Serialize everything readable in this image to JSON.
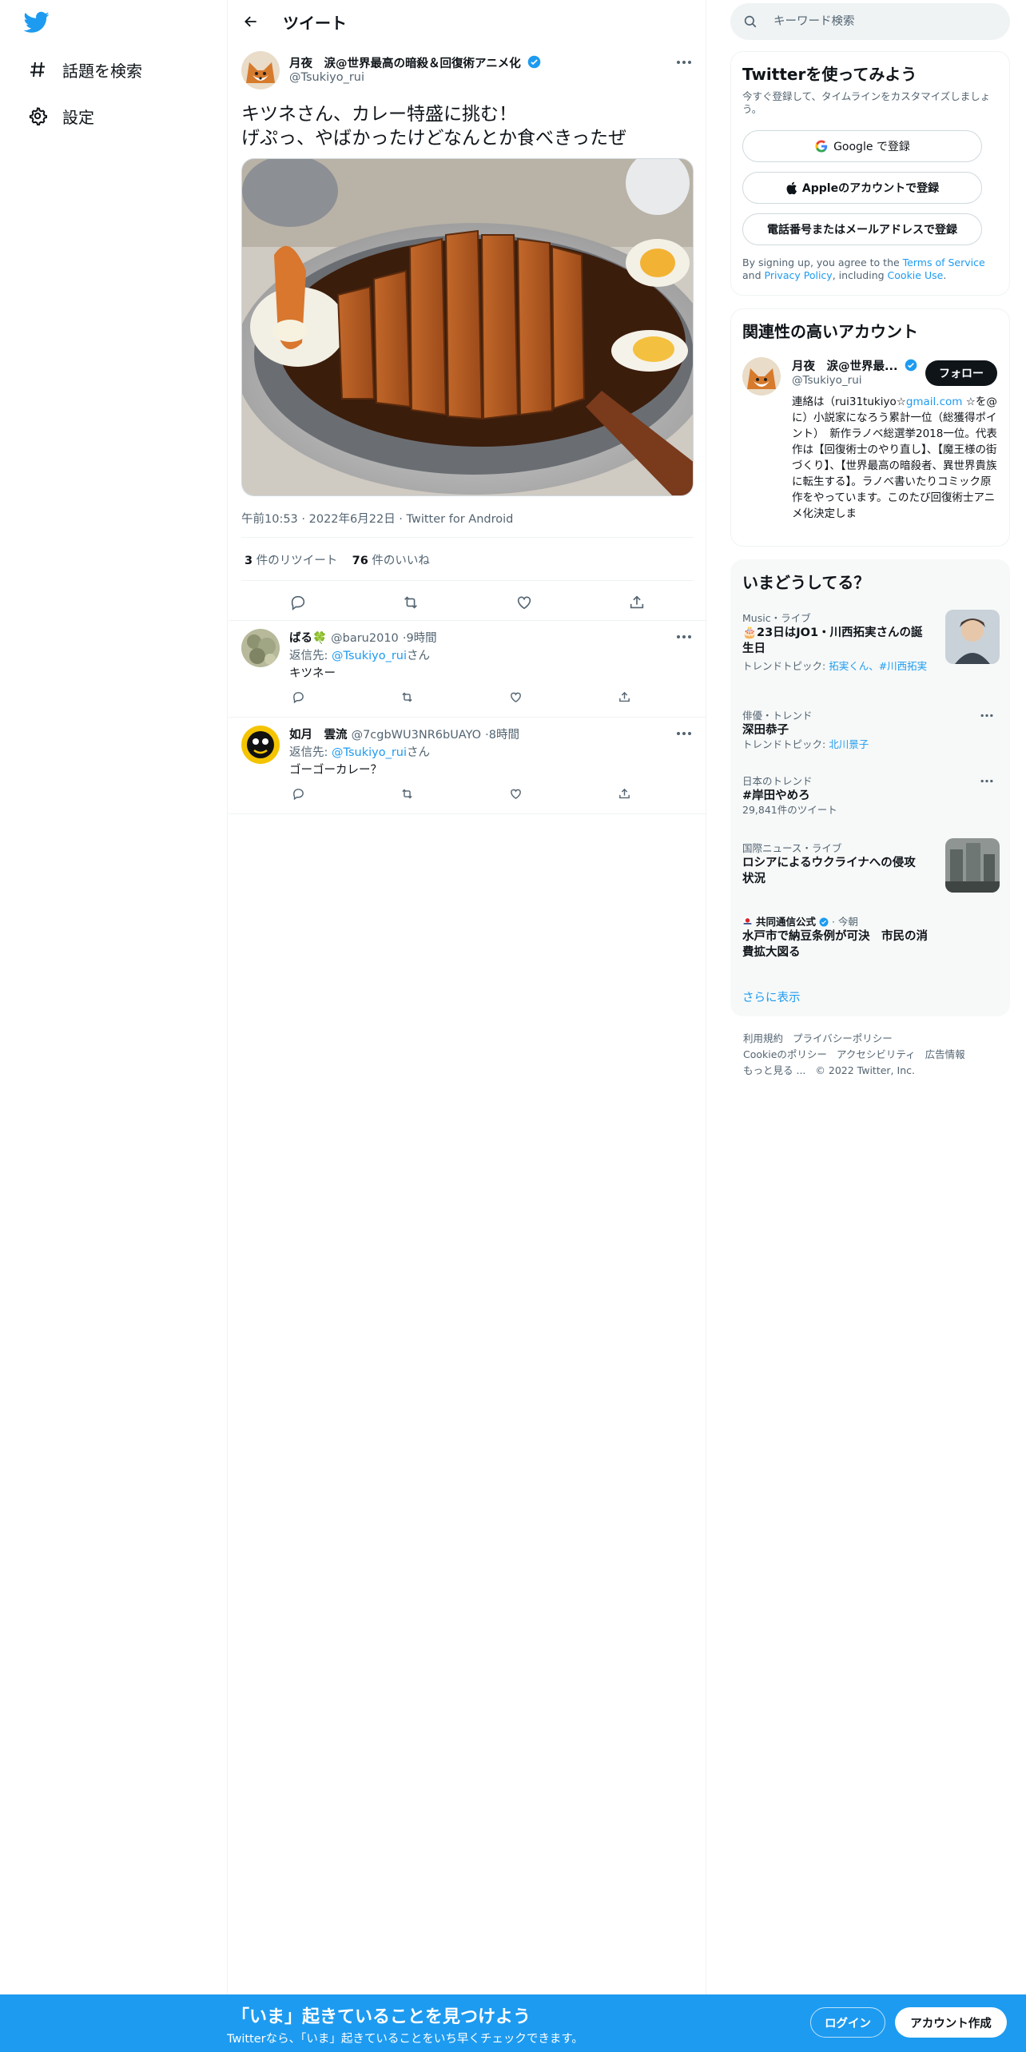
{
  "colors": {
    "brand": "#1d9bf0",
    "text": "#0f1419",
    "muted": "#536471",
    "border": "#eff3f4",
    "bottom_bar": "#1d9bf0"
  },
  "nav": {
    "logo_icon": "twitter-bird-icon",
    "items": [
      {
        "icon": "hashtag-icon",
        "label": "話題を検索"
      },
      {
        "icon": "gear-icon",
        "label": "設定"
      }
    ]
  },
  "main": {
    "header_title": "ツイート",
    "tweet": {
      "author_name": "月夜　涙@世界最高の暗殺＆回復術アニメ化",
      "author_handle": "@Tsukiyo_rui",
      "text": "キツネさん、カレー特盛に挑む！\nげぷっ、やばかったけどなんとか食べきったぜ",
      "photo_alt": "カツカレー",
      "meta": "午前10:53 · 2022年6月22日 · Twitter for Android",
      "retweets_count": "3",
      "retweets_label": " 件のリツイート",
      "likes_count": "76",
      "likes_label": " 件のいいね"
    },
    "replies": [
      {
        "name": "ばる🍀",
        "handle": "@baru2010",
        "time": "9時間",
        "reply_to_label": "返信先: ",
        "reply_to_handle": "@Tsukiyo_rui",
        "reply_to_suffix": "さん",
        "text": "キツネー"
      },
      {
        "name": "如月　雲流",
        "handle": "@7cgbWU3NR6bUAYO",
        "time": "8時間",
        "reply_to_label": "返信先: ",
        "reply_to_handle": "@Tsukiyo_rui",
        "reply_to_suffix": "さん",
        "text": "ゴーゴーカレー？"
      }
    ]
  },
  "sidebar": {
    "search_placeholder": "キーワード検索",
    "signup": {
      "title": "Twitterを使ってみよう",
      "desc": "今すぐ登録して、タイムラインをカスタマイズしましょう。",
      "google": "Google で登録",
      "apple": "Appleのアカウントで登録",
      "phone": "電話番号またはメールアドレスで登録",
      "terms_pre": "By signing up, you agree to the ",
      "terms_link": "Terms of Service",
      "terms_and": " and ",
      "privacy_link": "Privacy Policy",
      "terms_mid": ", including ",
      "cookie_link": "Cookie Use",
      "terms_end": "."
    },
    "related": {
      "title": "関連性の高いアカウント",
      "name": "月夜　涙@世界最...",
      "handle": "@Tsukiyo_rui",
      "follow": "フォロー",
      "bio_pre": "連絡は（rui31tukiyo☆",
      "bio_link": "gmail.com",
      "bio_post": " ☆を@に）小説家になろう累計一位（総獲得ポイント）　新作ラノベ総選挙2018一位。代表作は【回復術士のやり直し】、【魔王様の街づくり】、【世界最高の暗殺者、異世界貴族に転生する】。ラノベ書いたりコミック原作をやっています。このたび回復術士アニメ化決定しま"
    },
    "trends": {
      "title": "いまどうしてる？",
      "items": [
        {
          "context": "Music・ライブ",
          "title": "🎂23日はJO1・川西拓実さんの誕生日",
          "sub_label": "トレンドトピック: ",
          "sub_link": "拓実くん、#川西拓実"
        },
        {
          "context": "俳優・トレンド",
          "title": "深田恭子",
          "sub_label": "トレンドトピック: ",
          "sub_link": "北川景子"
        },
        {
          "context": "日本のトレンド",
          "title": "#岸田やめろ",
          "sub_text": "29,841件のツイート"
        },
        {
          "context": "国際ニュース・ライブ",
          "title": "ロシアによるウクライナへの侵攻状況"
        },
        {
          "context_source": "共同通信公式",
          "context_time": " · 今朝",
          "title": "水戸市で納豆条例が可決　市民の消費拡大図る"
        }
      ],
      "show_more": "さらに表示"
    },
    "footer": {
      "links": [
        "利用規約",
        "プライバシーポリシー",
        "Cookieのポリシー",
        "アクセシビリティ",
        "広告情報",
        "もっと見る ..."
      ],
      "copyright": "© 2022 Twitter, Inc."
    }
  },
  "bottom_bar": {
    "headline": "「いま」起きていることを見つけよう",
    "subtext": "Twitterなら、「いま」起きていることをいち早くチェックできます。",
    "login": "ログイン",
    "signup": "アカウント作成"
  }
}
